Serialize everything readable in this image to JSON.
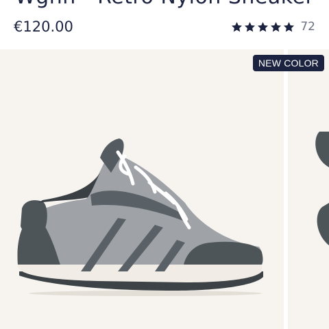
{
  "product": {
    "title": "Wgnn - Retro Nylon Sneaker",
    "price": "€120.00",
    "rating": {
      "stars": 5,
      "review_count": "72"
    }
  },
  "gallery": {
    "badge": "NEW COLOR",
    "images": [
      {
        "icon": "sneaker-side-view-image"
      },
      {
        "icon": "sneaker-partial-image"
      }
    ]
  },
  "colors": {
    "navy": "#1c2340",
    "image_background": "#f7f4f0",
    "shoe_upper": "#9fa3a7",
    "shoe_suede": "#4d5559",
    "sole": "#f1ede6"
  }
}
